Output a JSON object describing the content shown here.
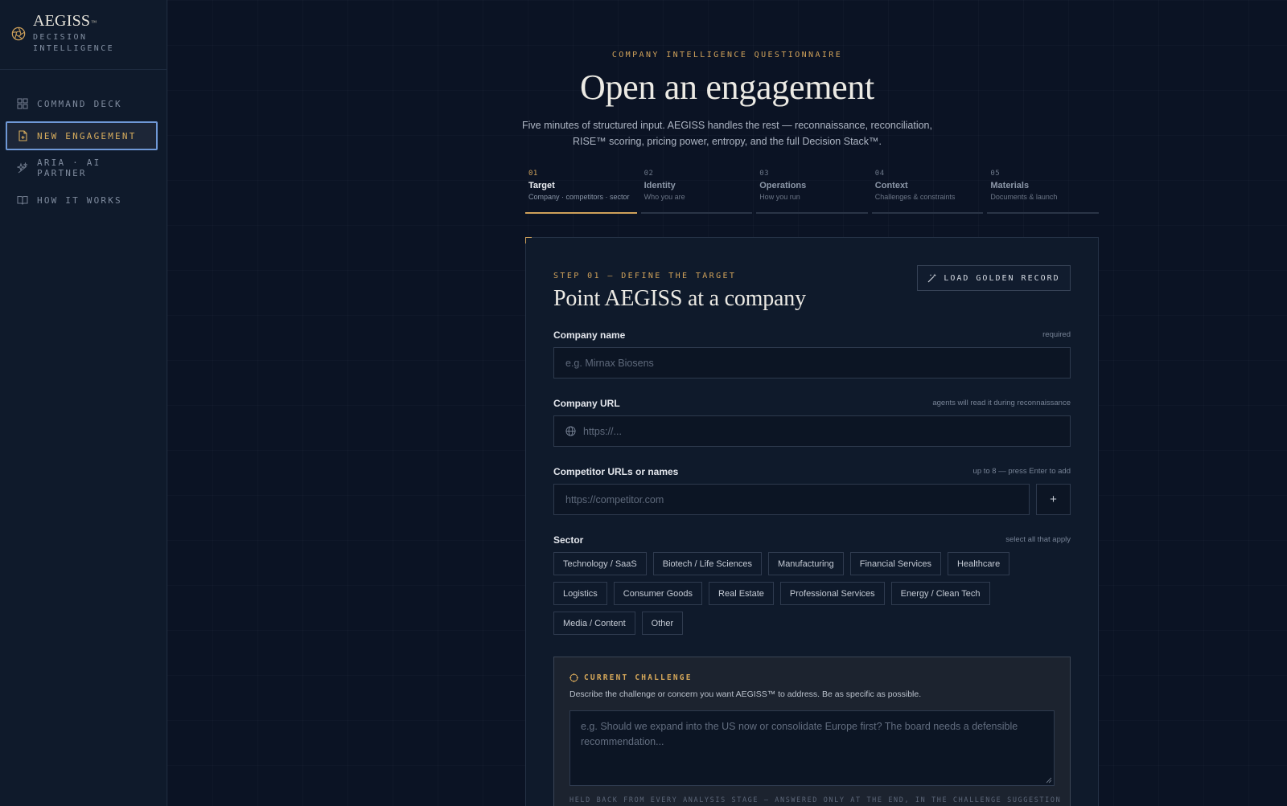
{
  "brand": {
    "name": "AEGISS",
    "tm": "™",
    "subtitle": "DECISION INTELLIGENCE",
    "logo_icon": "aperture-icon",
    "accent": "#cfa15a"
  },
  "sidebar": {
    "items": [
      {
        "label": "COMMAND DECK",
        "icon": "grid-icon",
        "active": false
      },
      {
        "label": "NEW ENGAGEMENT",
        "icon": "document-icon",
        "active": true
      },
      {
        "label": "ARIA · AI PARTNER",
        "icon": "sparkle-icon",
        "active": false
      },
      {
        "label": "HOW IT WORKS",
        "icon": "book-icon",
        "active": false
      }
    ]
  },
  "header": {
    "eyebrow": "COMPANY INTELLIGENCE QUESTIONNAIRE",
    "title": "Open an engagement",
    "subtitle": "Five minutes of structured input. AEGISS handles the rest — reconnaissance, reconciliation, RISE™ scoring, pricing power, entropy, and the full Decision Stack™."
  },
  "stepper": {
    "steps": [
      {
        "num": "01",
        "name": "Target",
        "desc": "Company · competitors · sector",
        "active": true
      },
      {
        "num": "02",
        "name": "Identity",
        "desc": "Who you are",
        "active": false
      },
      {
        "num": "03",
        "name": "Operations",
        "desc": "How you run",
        "active": false
      },
      {
        "num": "04",
        "name": "Context",
        "desc": "Challenges & constraints",
        "active": false
      },
      {
        "num": "05",
        "name": "Materials",
        "desc": "Documents & launch",
        "active": false
      }
    ]
  },
  "card": {
    "eyebrow": "STEP 01 — DEFINE THE TARGET",
    "title": "Point AEGISS at a company",
    "golden_button": "LOAD GOLDEN RECORD",
    "company_name": {
      "label": "Company name",
      "hint": "required",
      "placeholder": "e.g. Mirnax Biosens",
      "value": ""
    },
    "company_url": {
      "label": "Company URL",
      "hint": "agents will read it during reconnaissance",
      "placeholder": "https://...",
      "value": ""
    },
    "competitors": {
      "label": "Competitor URLs or names",
      "hint": "up to 8 — press Enter to add",
      "placeholder": "https://competitor.com",
      "add_label": "+"
    },
    "sector": {
      "label": "Sector",
      "hint": "select all that apply",
      "rows": [
        [
          "Technology / SaaS",
          "Biotech / Life Sciences",
          "Manufacturing",
          "Financial Services",
          "Healthcare"
        ],
        [
          "Logistics",
          "Consumer Goods",
          "Real Estate",
          "Professional Services",
          "Energy / Clean Tech"
        ],
        [
          "Media / Content",
          "Other"
        ]
      ]
    },
    "challenge": {
      "label": "CURRENT CHALLENGE",
      "description": "Describe the challenge or concern you want AEGISS™ to address. Be as specific as possible.",
      "placeholder": "e.g. Should we expand into the US now or consolidate Europe first? The board needs a defensible recommendation...",
      "footnote": "HELD BACK FROM EVERY ANALYSIS STAGE — ANSWERED ONLY AT THE END, IN THE CHALLENGE SUGGESTION"
    }
  }
}
